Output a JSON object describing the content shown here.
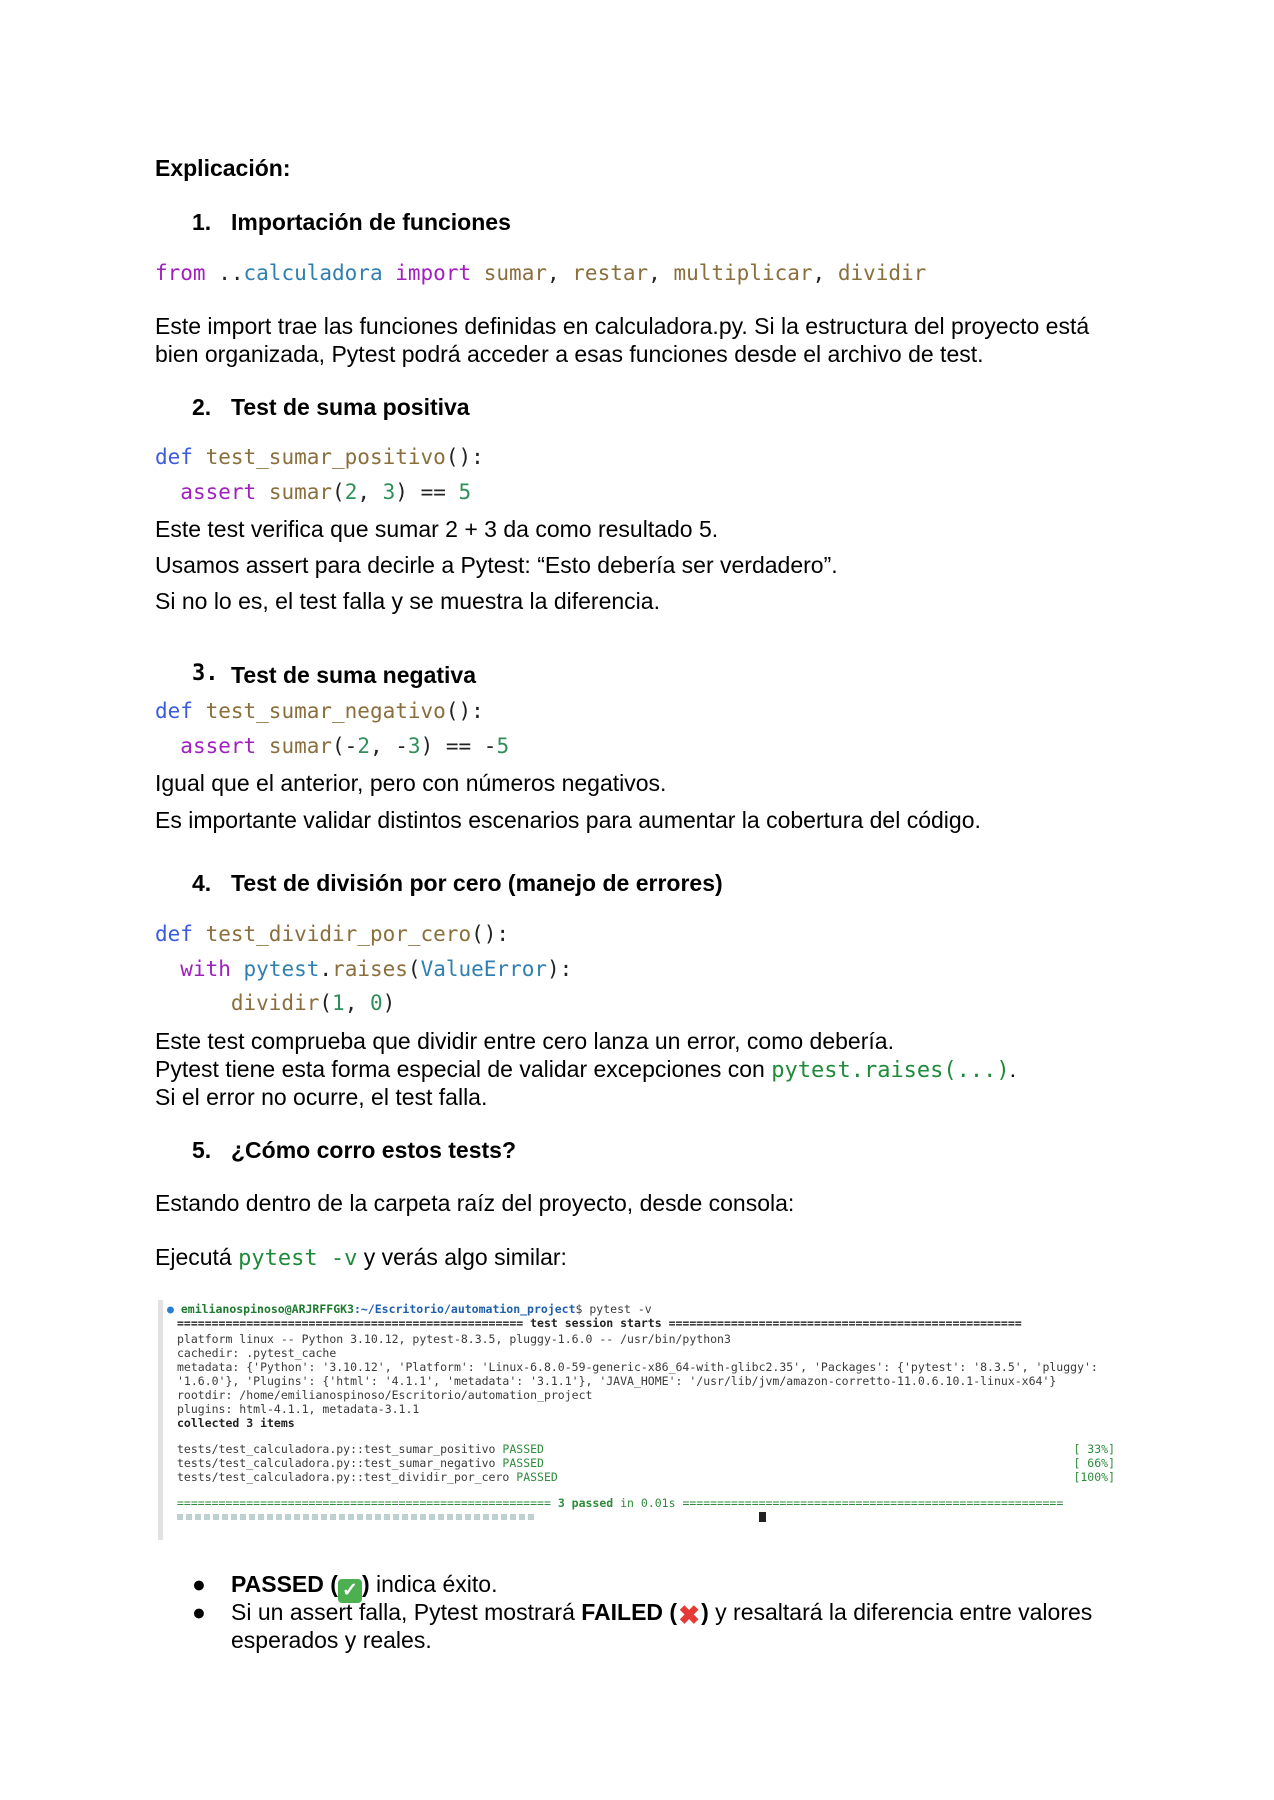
{
  "heading": "Explicación:",
  "s1": {
    "num": "1.",
    "title": "Importación de funciones",
    "code": {
      "from": "from",
      "dots": " ..",
      "module": "calculadora",
      "import": "import",
      "f1": "sumar",
      "f2": "restar",
      "f3": "multiplicar",
      "f4": "dividir"
    },
    "p1": "Este import trae las funciones definidas en calculadora.py. Si la estructura del proyecto está",
    "p2": "bien organizada, Pytest podrá acceder a esas funciones desde el archivo de test."
  },
  "s2": {
    "num": "2.",
    "title": "Test de suma positiva",
    "def_kw": "def",
    "fn_name": "test_sumar_positivo",
    "assert_kw": "assert",
    "call": "sumar",
    "a": "2",
    "b": "3",
    "result": "5",
    "p1": "Este test verifica que sumar 2 + 3 da como resultado 5.",
    "p2": "Usamos assert para decirle a Pytest: “Esto debería ser verdadero”.",
    "p3": "Si no lo es, el test falla y se muestra la diferencia."
  },
  "s3": {
    "num": "3.",
    "title": "Test de suma negativa",
    "def_kw": "def",
    "fn_name": "test_sumar_negativo",
    "assert_kw": "assert",
    "call": "sumar",
    "a": "2",
    "b": "3",
    "result": "5",
    "p1": "Igual que el anterior, pero con números negativos.",
    "p2": "Es importante validar distintos escenarios para aumentar la cobertura del código."
  },
  "s4": {
    "num": "4.",
    "title": "Test de división por cero (manejo de errores)",
    "def_kw": "def",
    "fn_name": "test_dividir_por_cero",
    "with_kw": "with",
    "mod": "pytest",
    "method": "raises",
    "exc": "ValueError",
    "call": "dividir",
    "a": "1",
    "b": "0",
    "p1": "Este test comprueba que dividir entre cero lanza un error, como debería.",
    "p2a": "Pytest tiene esta forma especial de validar excepciones con ",
    "p2code": "pytest.raises(...)",
    "p2b": ".",
    "p3": "Si el error no ocurre, el test falla."
  },
  "s5": {
    "num": "5.",
    "title": "¿Cómo corro estos tests?",
    "p1": "Estando dentro de la carpeta raíz del proyecto, desde consola:",
    "p2a": "Ejecutá ",
    "p2code": "pytest -v",
    "p2b": " y verás algo similar:"
  },
  "terminal": {
    "prompt_user": "emilianospinoso@ARJRFFGK3",
    "prompt_path": ":~/Escritorio/automation_project",
    "prompt_cmd": "$ pytest -v",
    "session_line": "================================================== test session starts ===================================================",
    "l1": "platform linux -- Python 3.10.12, pytest-8.3.5, pluggy-1.6.0 -- /usr/bin/python3",
    "l2": "cachedir: .pytest_cache",
    "l3": "metadata: {'Python': '3.10.12', 'Platform': 'Linux-6.8.0-59-generic-x86_64-with-glibc2.35', 'Packages': {'pytest': '8.3.5', 'pluggy':",
    "l4": "'1.6.0'}, 'Plugins': {'html': '4.1.1', 'metadata': '3.1.1'}, 'JAVA_HOME': '/usr/lib/jvm/amazon-corretto-11.0.6.10.1-linux-x64'}",
    "l5": "rootdir: /home/emilianospinoso/Escritorio/automation_project",
    "l6": "plugins: html-4.1.1, metadata-3.1.1",
    "l7": "collected 3 items",
    "t1": "tests/test_calculadora.py::test_sumar_positivo ",
    "t2": "tests/test_calculadora.py::test_sumar_negativo ",
    "t3": "tests/test_calculadora.py::test_dividir_por_cero ",
    "passed": "PASSED",
    "p1": "[ 33%]",
    "p2": "[ 66%]",
    "p3": "[100%]",
    "summary_left": "====================================================== ",
    "summary_mid": "3 passed",
    "summary_time": " in 0.01s ",
    "summary_right": "======================================================="
  },
  "bullets": {
    "b1_bold": "PASSED (",
    "b1_close": ")",
    "b1_rest": " indica éxito.",
    "b2_a": "Si un assert falla, Pytest mostrará ",
    "b2_bold": "FAILED (",
    "b2_close": ")",
    "b2_b": " y resaltará la diferencia entre valores",
    "b2_c": "esperados y reales.",
    "check_icon": "check-mark-icon",
    "cross_icon": "cross-mark-icon"
  }
}
